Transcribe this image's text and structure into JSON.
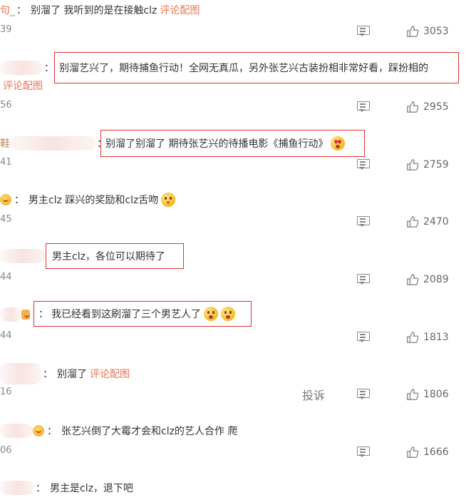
{
  "comments": [
    {
      "name": "句_",
      "colon": "：",
      "text": "别溜了 我听到的是在接触clz",
      "link": "评论配图",
      "num": "39",
      "likes": "3053"
    },
    {
      "colon": "：",
      "text": "别溜艺兴了，期待捕鱼行动！全网无真瓜，另外张艺兴古装扮相非常好看，踩扮相的",
      "link": "评论配图",
      "num": "56",
      "likes": "2955"
    },
    {
      "name": "鞋",
      "colon": "：",
      "text": "别溜了别溜了 期待张艺兴的待播电影《捕鱼行动》",
      "num": "41",
      "likes": "2759"
    },
    {
      "colon": "：",
      "text": "男主clz 踩兴的奖励和clz舌吻",
      "num": "45",
      "likes": "2470"
    },
    {
      "text": "男主clz，各位可以期待了",
      "num": "44",
      "likes": "2089"
    },
    {
      "colon": "：",
      "text": "我已经看到这刷溜了三个男艺人了",
      "num": "44",
      "likes": "1813"
    },
    {
      "colon": "：",
      "text": "别溜了",
      "link": "评论配图",
      "num": "16",
      "likes": "1806",
      "report": "投诉"
    },
    {
      "colon": "：",
      "text": "张艺兴倒了大霉才会和clz的艺人合作 爬",
      "num": "06",
      "likes": "1666"
    },
    {
      "colon": "：",
      "text": "男主是clz，退下吧"
    }
  ],
  "colors": {
    "accent": "#eb7350",
    "highlight_border": "#e0312f",
    "muted": "#888888"
  },
  "icons": {
    "comment": "comment-icon",
    "like": "thumbs-up-icon",
    "emoji": "emoji-icon"
  }
}
